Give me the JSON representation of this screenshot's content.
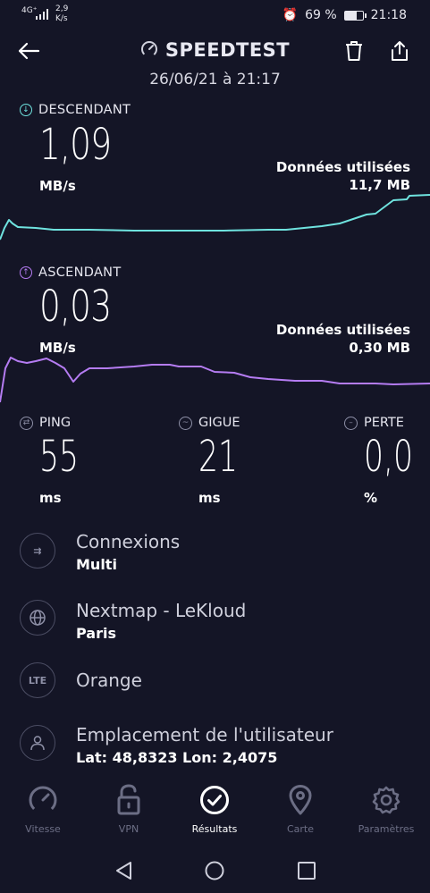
{
  "status_bar": {
    "network": "4G⁺",
    "rate_value": "2,9",
    "rate_unit": "K/s",
    "battery": "69 %",
    "time": "21:18"
  },
  "header": {
    "title": "SPEEDTEST",
    "datetime": "26/06/21 à 21:17"
  },
  "download": {
    "label": "DESCENDANT",
    "value": "1,09",
    "unit": "MB/s",
    "data_used_label": "Données utilisées",
    "data_used": "11,7 MB",
    "color": "#6fe3df"
  },
  "upload": {
    "label": "ASCENDANT",
    "value": "0,03",
    "unit": "MB/s",
    "data_used_label": "Données utilisées",
    "data_used": "0,30 MB",
    "color": "#b57cf2"
  },
  "metrics": {
    "ping": {
      "label": "PING",
      "value": "55",
      "unit": "ms"
    },
    "jitter": {
      "label": "GIGUE",
      "value": "21",
      "unit": "ms"
    },
    "loss": {
      "label": "PERTE",
      "value": "0,0",
      "unit": "%"
    }
  },
  "info": {
    "connections": {
      "title": "Connexions",
      "value": "Multi"
    },
    "server": {
      "title": "Nextmap - LeKloud",
      "value": "Paris"
    },
    "provider": {
      "badge": "LTE",
      "title": "Orange"
    },
    "location": {
      "title": "Emplacement de l'utilisateur",
      "value": "Lat: 48,8323 Lon: 2,4075"
    }
  },
  "nav": [
    {
      "label": "Vitesse",
      "icon": "speedometer-icon",
      "active": false
    },
    {
      "label": "VPN",
      "icon": "padlock-icon",
      "active": false
    },
    {
      "label": "Résultats",
      "icon": "check-circle-icon",
      "active": true
    },
    {
      "label": "Carte",
      "icon": "map-pin-icon",
      "active": false
    },
    {
      "label": "Paramètres",
      "icon": "gear-icon",
      "active": false
    }
  ]
}
